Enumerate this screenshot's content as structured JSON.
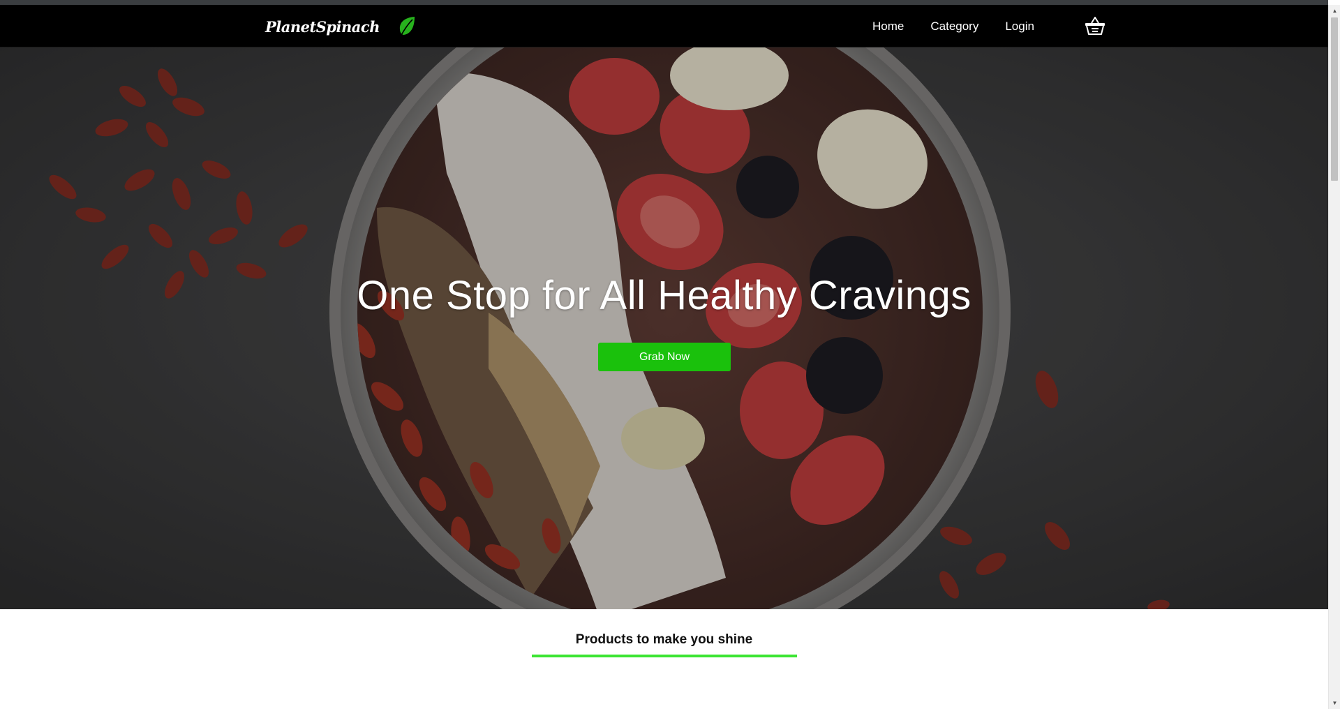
{
  "brand": {
    "name": "PlanetSpinach",
    "logo_icon": "leaf-icon",
    "leaf_color": "#27b21d"
  },
  "nav": {
    "links": [
      {
        "label": "Home"
      },
      {
        "label": "Category"
      },
      {
        "label": "Login"
      }
    ],
    "cart_icon": "basket-icon"
  },
  "hero": {
    "title": "One Stop for All Healthy Cravings",
    "button_label": "Grab Now",
    "button_color": "#1ac10c",
    "background_image": "acai bowl with goji berries, coconut, strawberries, banana and blackberries"
  },
  "products": {
    "heading": "Products to make you shine",
    "underline_color": "#3ce533"
  },
  "colors": {
    "navbar": "#000000",
    "accent_green": "#1ac10c"
  }
}
